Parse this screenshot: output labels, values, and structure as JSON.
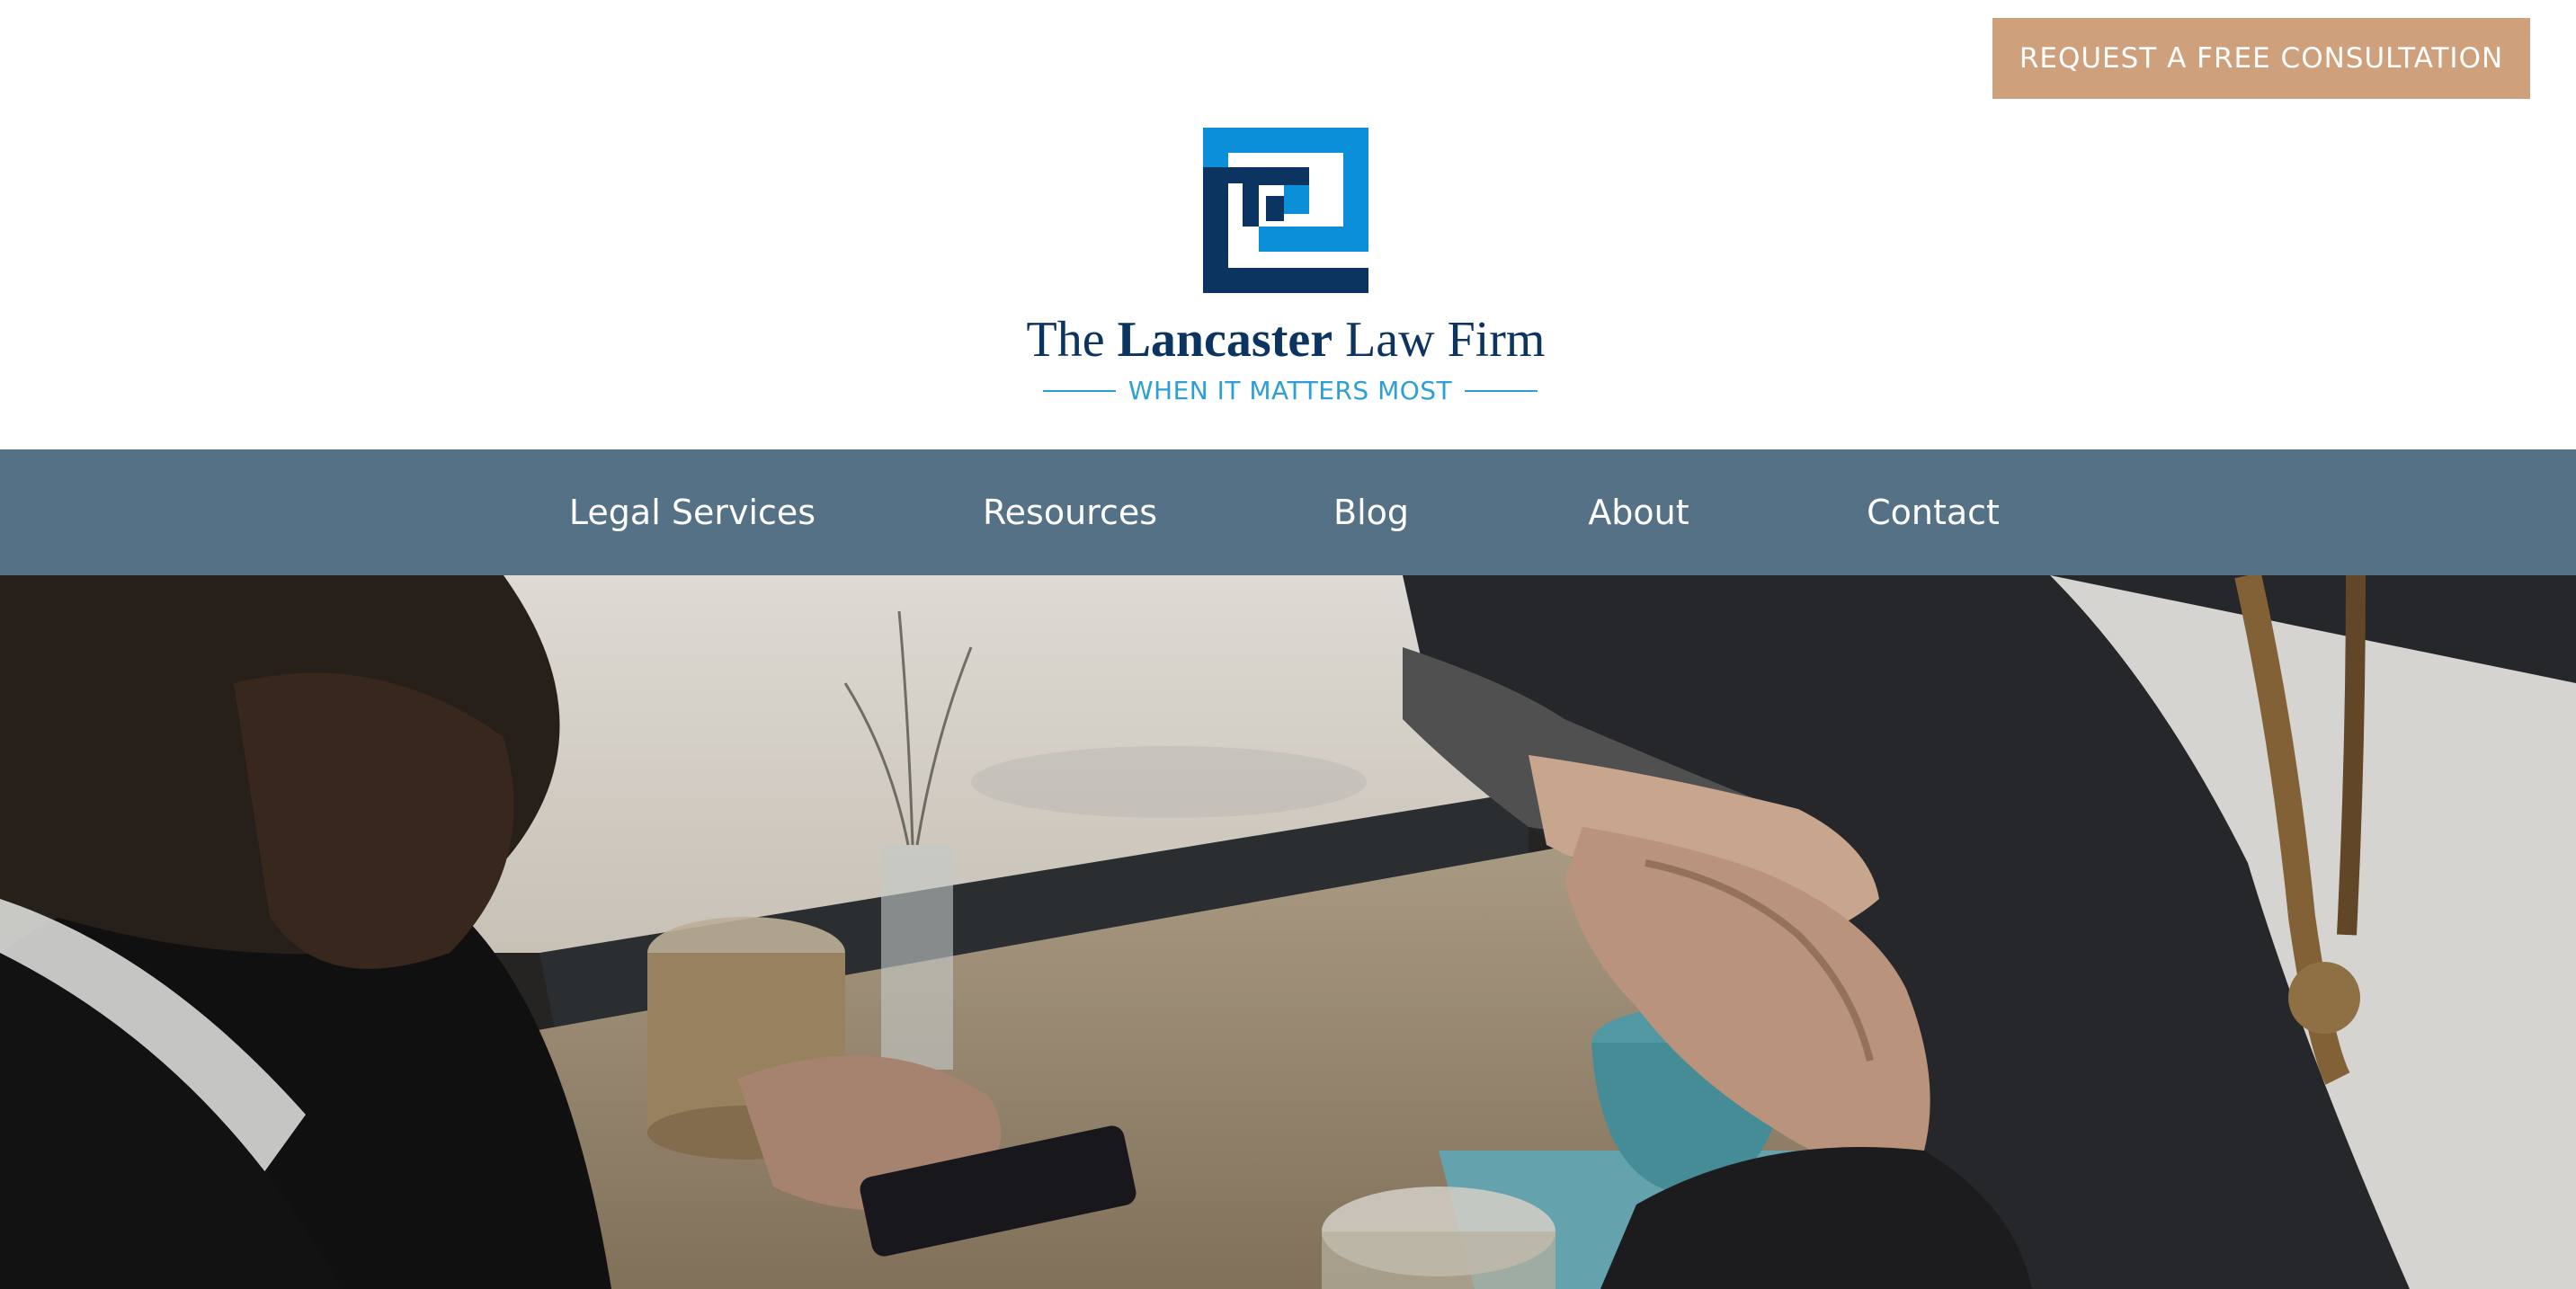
{
  "header": {
    "cta_label": "REQUEST A FREE CONSULTATION",
    "logo": {
      "name_prefix": "The",
      "name_strong": "Lancaster",
      "name_suffix": "Law Firm",
      "tagline": "WHEN IT MATTERS MOST",
      "colors": {
        "dark": "#0c3460",
        "light": "#0a8fd8"
      }
    }
  },
  "nav": {
    "items": [
      {
        "label": "Legal Services"
      },
      {
        "label": "Resources"
      },
      {
        "label": "Blog"
      },
      {
        "label": "About"
      },
      {
        "label": "Contact"
      }
    ],
    "background": "#557186"
  },
  "hero": {
    "image_description": "handshake-photo"
  },
  "colors": {
    "accent": "#cfa07c",
    "nav": "#557186",
    "brand_dark": "#0c3460",
    "brand_light": "#2b9fd6"
  }
}
